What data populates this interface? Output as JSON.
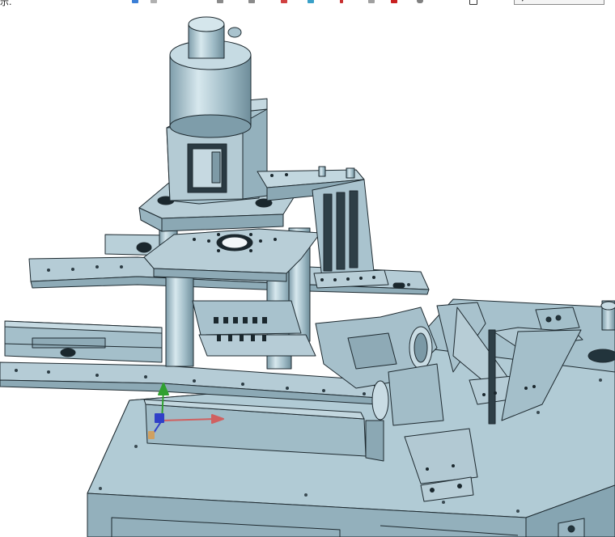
{
  "status": {
    "text": "示."
  },
  "toolbar": {
    "icons": [
      {
        "name": "view-icon",
        "color": "#3b7fd6"
      },
      {
        "name": "pen-icon",
        "color": "#b0b0b0"
      },
      {
        "name": "rotate-icon",
        "color": "#8a8a8a"
      },
      {
        "name": "display-icon",
        "color": "#8a8a8a"
      },
      {
        "name": "color-icon",
        "color": "#d04040"
      },
      {
        "name": "layer-icon",
        "color": "#3aa0c8"
      },
      {
        "name": "marker-icon",
        "color": "#c83030"
      },
      {
        "name": "sheet-icon",
        "color": "#a0a0a0"
      },
      {
        "name": "record-icon",
        "color": "#c82020"
      },
      {
        "name": "settings-icon",
        "color": "#808080"
      }
    ],
    "dropdown_value": ""
  },
  "model": {
    "body_color": "#a9c4cf",
    "edge_color": "#1e2a30",
    "triad_axes": {
      "x": "#d06060",
      "y": "#30a030",
      "z": "#3040c8"
    }
  }
}
